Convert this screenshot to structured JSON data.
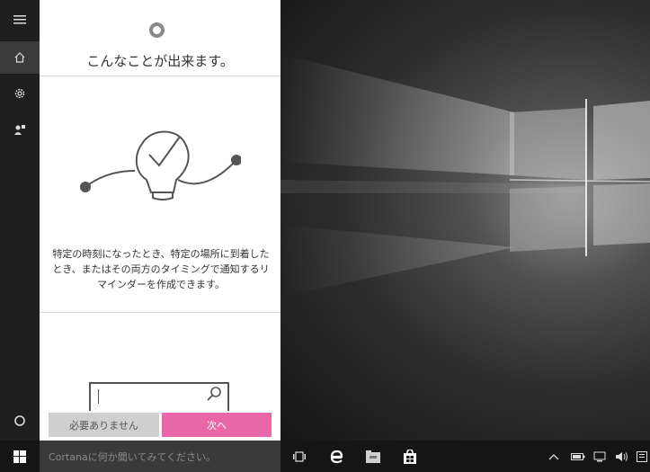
{
  "cortana": {
    "title": "こんなことが出来ます。",
    "description": "特定の時刻になったとき、特定の場所に到着したとき、またはその両方のタイミングで通知するリマインダーを作成できます。",
    "skip_label": "必要ありません",
    "next_label": "次へ",
    "search_placeholder": "Cortanaに何か聞いてみてください。"
  },
  "colors": {
    "accent_pink": "#e867a8",
    "rail_bg": "#1f1f1f",
    "taskbar_bg": "#151515"
  },
  "icons": {
    "rail": [
      "hamburger-menu-icon",
      "home-icon",
      "settings-icon",
      "feedback-icon",
      "cortana-circle-icon"
    ],
    "taskbar": [
      "windows-start-icon",
      "task-view-icon",
      "edge-icon",
      "file-explorer-icon",
      "store-icon"
    ],
    "tray": [
      "chevron-up-icon",
      "battery-icon",
      "network-icon",
      "volume-icon",
      "notification-icon"
    ]
  }
}
